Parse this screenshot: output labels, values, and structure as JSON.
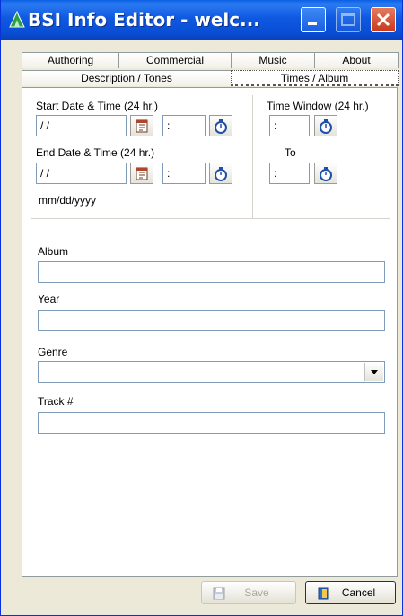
{
  "window": {
    "title": "BSI Info Editor - welc..."
  },
  "tabs": {
    "top": [
      {
        "label": "Authoring",
        "underline": "A"
      },
      {
        "label": "Commercial",
        "underline": "C"
      },
      {
        "label": "Music",
        "underline": ""
      },
      {
        "label": "About",
        "underline": "b"
      }
    ],
    "bottom": [
      {
        "label": "Description / Tones",
        "underline": "D"
      },
      {
        "label": "Times / Album",
        "underline": "T"
      }
    ],
    "active": "Times / Album"
  },
  "times": {
    "start_label": "Start Date & Time (24 hr.)",
    "start_date": "/ /",
    "start_time": ":",
    "end_label": "End Date & Time (24 hr.)",
    "end_date": "/ /",
    "end_time": ":",
    "date_format": "mm/dd/yyyy",
    "window_label": "Time Window (24 hr.)",
    "window_from": ":",
    "to_label": "To",
    "window_to": ":"
  },
  "album": {
    "album_label": "Album",
    "album_value": "",
    "year_label": "Year",
    "year_value": "",
    "genre_label": "Genre",
    "genre_value": "",
    "track_label": "Track #",
    "track_value": ""
  },
  "buttons": {
    "save": "Save",
    "cancel": "Cancel"
  },
  "colors": {
    "titlebar": "#0A4FD6",
    "face": "#ECE9D8",
    "close": "#C8381A"
  }
}
